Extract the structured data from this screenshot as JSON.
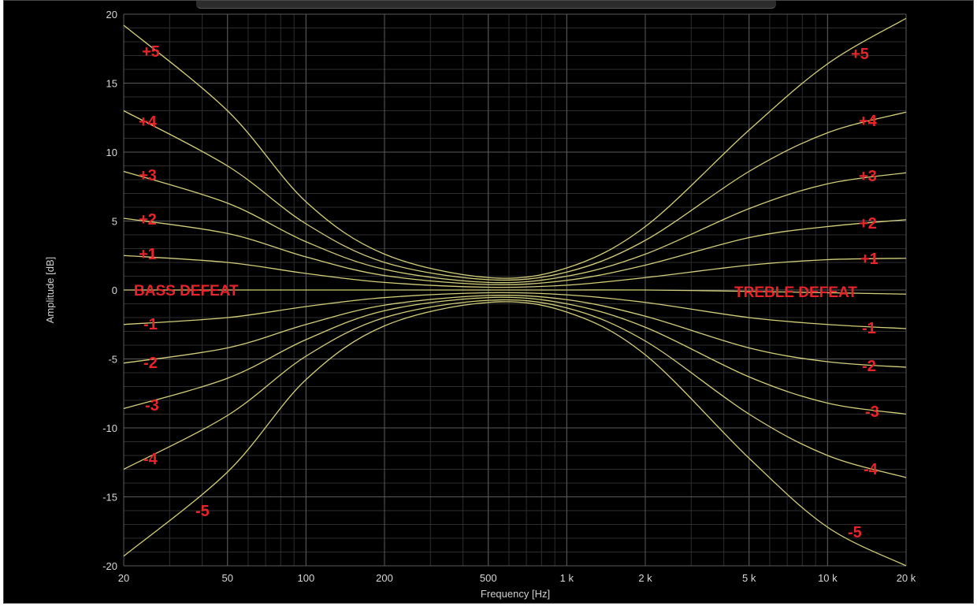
{
  "colors": {
    "background": "#000000",
    "grid_major": "#5a5a5a",
    "grid_minor": "#2e2e2e",
    "curve": "#d4cf7a",
    "annotation": "#e8242a",
    "tick_text": "#d8d8d8"
  },
  "chart_data": {
    "type": "line",
    "xlabel": "Frequency [Hz]",
    "ylabel": "Amplitude [dB]",
    "xscale": "log",
    "xlim": [
      20,
      20000
    ],
    "ylim": [
      -20,
      20
    ],
    "grid": true,
    "x_ticks": [
      20,
      50,
      100,
      200,
      500,
      1000,
      2000,
      5000,
      10000,
      20000
    ],
    "x_tick_labels": [
      "20",
      "50",
      "100",
      "200",
      "500",
      "1 k",
      "2 k",
      "5 k",
      "10 k",
      "20 k"
    ],
    "y_ticks": [
      20,
      15,
      10,
      5,
      0,
      -5,
      -10,
      -15,
      -20
    ],
    "y_tick_labels": [
      "20",
      "15",
      "10",
      "5",
      "0",
      "-5",
      "-10",
      "-15",
      "-20"
    ],
    "x": [
      20,
      50,
      100,
      200,
      500,
      1000,
      2000,
      5000,
      10000,
      20000
    ],
    "series": [
      {
        "values": [
          19.2,
          13.0,
          6.4,
          2.6,
          0.9,
          1.6,
          4.6,
          11.6,
          16.4,
          19.7
        ]
      },
      {
        "values": [
          13.0,
          9.0,
          4.8,
          2.0,
          0.75,
          1.3,
          3.6,
          8.6,
          11.4,
          12.9
        ]
      },
      {
        "values": [
          8.6,
          6.3,
          3.5,
          1.5,
          0.55,
          1.0,
          2.6,
          5.9,
          7.7,
          8.5
        ]
      },
      {
        "values": [
          5.2,
          4.1,
          2.4,
          1.05,
          0.4,
          0.7,
          1.8,
          3.8,
          4.6,
          5.1
        ]
      },
      {
        "values": [
          2.5,
          2.0,
          1.2,
          0.55,
          0.2,
          0.35,
          0.9,
          1.8,
          2.2,
          2.3
        ]
      },
      {
        "values": [
          0.0,
          0.0,
          0.0,
          0.0,
          0.0,
          0.0,
          0.0,
          -0.1,
          -0.2,
          -0.3
        ]
      },
      {
        "values": [
          -2.5,
          -2.0,
          -1.2,
          -0.55,
          -0.2,
          -0.35,
          -0.9,
          -2.0,
          -2.5,
          -2.8
        ]
      },
      {
        "values": [
          -5.3,
          -4.2,
          -2.5,
          -1.1,
          -0.4,
          -0.7,
          -1.9,
          -4.2,
          -5.2,
          -5.6
        ]
      },
      {
        "values": [
          -8.6,
          -6.4,
          -3.6,
          -1.5,
          -0.55,
          -1.0,
          -2.7,
          -6.3,
          -8.2,
          -9.0
        ]
      },
      {
        "values": [
          -13.0,
          -9.1,
          -4.8,
          -2.0,
          -0.75,
          -1.3,
          -3.7,
          -9.0,
          -12.0,
          -13.6
        ]
      },
      {
        "values": [
          -19.3,
          -13.2,
          -6.5,
          -2.6,
          -0.9,
          -1.6,
          -4.7,
          -12.2,
          -17.2,
          -20.0
        ]
      }
    ],
    "annotations": {
      "left": [
        "+5",
        "+4",
        "+3",
        "+2",
        "+1",
        "BASS DEFEAT",
        "-1",
        "-2",
        "-3",
        "-4",
        "-5"
      ],
      "right": [
        "+5",
        "+4",
        "+3",
        "+2",
        "+1",
        "TREBLE DEFEAT",
        "-1",
        "-2",
        "-3",
        "-4",
        "-5"
      ]
    }
  }
}
